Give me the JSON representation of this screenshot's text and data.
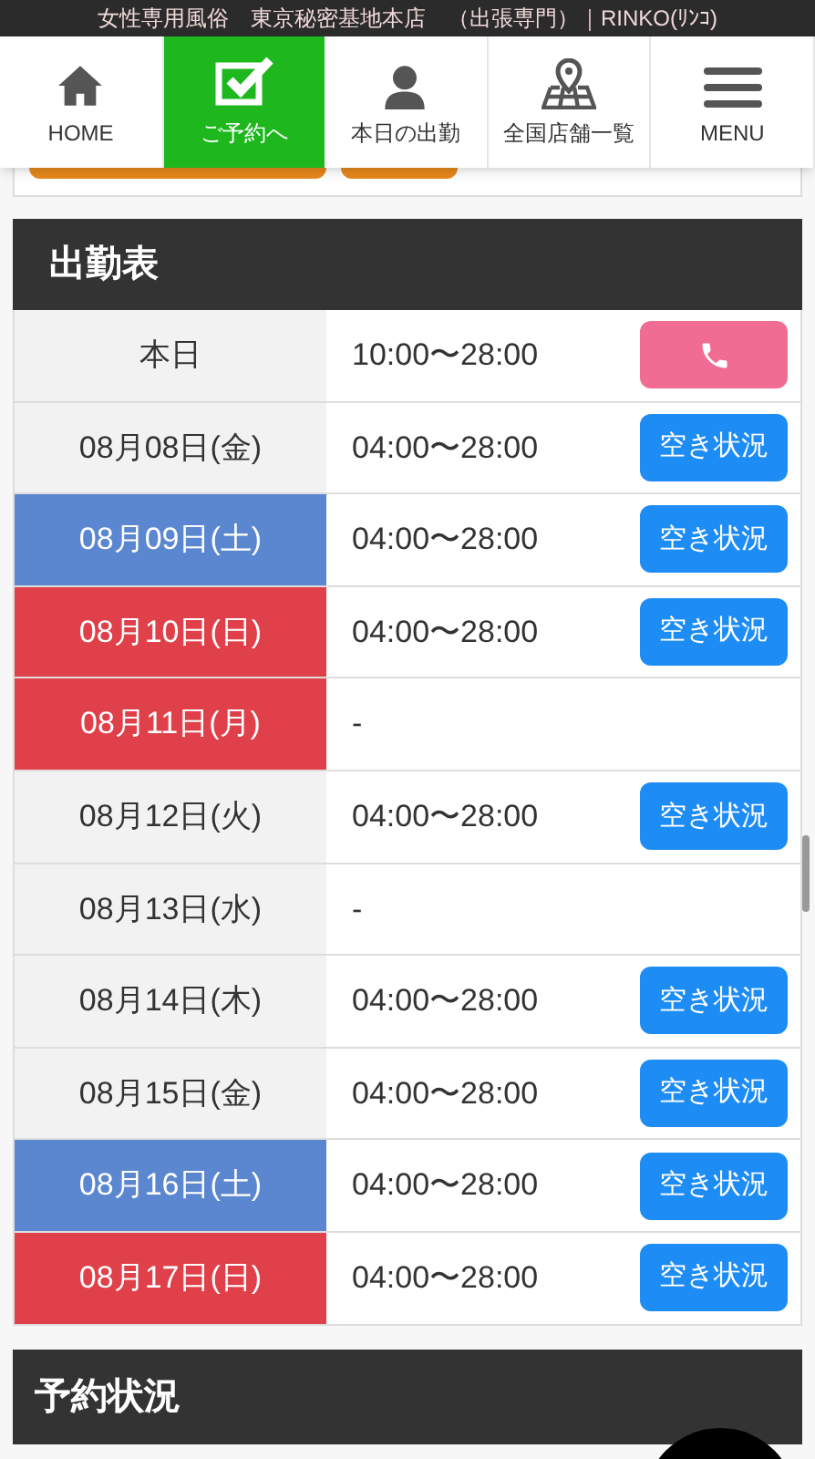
{
  "top_bar": {
    "text": "女性専用風俗　東京秘密基地本店　（出張専門）｜RINKO(ﾘﾝｺ)"
  },
  "nav": [
    {
      "label": "HOME",
      "selected": false
    },
    {
      "label": "ご予約へ",
      "selected": true
    },
    {
      "label": "本日の出勤",
      "selected": false
    },
    {
      "label": "全国店舗一覧",
      "selected": false
    },
    {
      "label": "MENU",
      "selected": false
    }
  ],
  "schedule": {
    "title": "出勤表",
    "rows": [
      {
        "date": "本日",
        "color": "#f2f2f2",
        "hours": "10:00〜28:00",
        "button": {
          "kind": "call"
        }
      },
      {
        "date": "08月08日(金)",
        "color": "#f2f2f2",
        "hours": "04:00〜28:00",
        "button": {
          "kind": "status",
          "label": "空き状況"
        }
      },
      {
        "date": "08月09日(土)",
        "color": "#5b87d0",
        "hours": "04:00〜28:00",
        "button": {
          "kind": "status",
          "label": "空き状況"
        }
      },
      {
        "date": "08月10日(日)",
        "color": "#e0404a",
        "hours": "04:00〜28:00",
        "button": {
          "kind": "status",
          "label": "空き状況"
        }
      },
      {
        "date": "08月11日(月)",
        "color": "#e0404a",
        "hours": "-"
      },
      {
        "date": "08月12日(火)",
        "color": "#f2f2f2",
        "hours": "04:00〜28:00",
        "button": {
          "kind": "status",
          "label": "空き状況"
        }
      },
      {
        "date": "08月13日(水)",
        "color": "#f2f2f2",
        "hours": "-"
      },
      {
        "date": "08月14日(木)",
        "color": "#f2f2f2",
        "hours": "04:00〜28:00",
        "button": {
          "kind": "status",
          "label": "空き状況"
        }
      },
      {
        "date": "08月15日(金)",
        "color": "#f2f2f2",
        "hours": "04:00〜28:00",
        "button": {
          "kind": "status",
          "label": "空き状況"
        }
      },
      {
        "date": "08月16日(土)",
        "color": "#5b87d0",
        "hours": "04:00〜28:00",
        "button": {
          "kind": "status",
          "label": "空き状況"
        }
      },
      {
        "date": "08月17日(日)",
        "color": "#e0404a",
        "hours": "04:00〜28:00",
        "button": {
          "kind": "status",
          "label": "空き状況"
        }
      }
    ]
  },
  "reservation": {
    "title": "予約状況"
  }
}
